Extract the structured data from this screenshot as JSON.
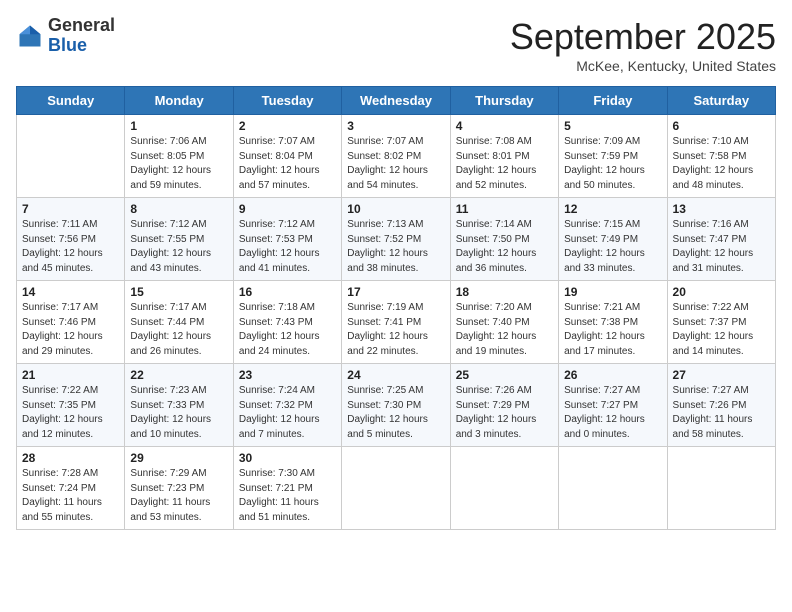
{
  "logo": {
    "general": "General",
    "blue": "Blue"
  },
  "header": {
    "month": "September 2025",
    "location": "McKee, Kentucky, United States"
  },
  "weekdays": [
    "Sunday",
    "Monday",
    "Tuesday",
    "Wednesday",
    "Thursday",
    "Friday",
    "Saturday"
  ],
  "weeks": [
    [
      {
        "day": "",
        "sunrise": "",
        "sunset": "",
        "daylight": ""
      },
      {
        "day": "1",
        "sunrise": "Sunrise: 7:06 AM",
        "sunset": "Sunset: 8:05 PM",
        "daylight": "Daylight: 12 hours and 59 minutes."
      },
      {
        "day": "2",
        "sunrise": "Sunrise: 7:07 AM",
        "sunset": "Sunset: 8:04 PM",
        "daylight": "Daylight: 12 hours and 57 minutes."
      },
      {
        "day": "3",
        "sunrise": "Sunrise: 7:07 AM",
        "sunset": "Sunset: 8:02 PM",
        "daylight": "Daylight: 12 hours and 54 minutes."
      },
      {
        "day": "4",
        "sunrise": "Sunrise: 7:08 AM",
        "sunset": "Sunset: 8:01 PM",
        "daylight": "Daylight: 12 hours and 52 minutes."
      },
      {
        "day": "5",
        "sunrise": "Sunrise: 7:09 AM",
        "sunset": "Sunset: 7:59 PM",
        "daylight": "Daylight: 12 hours and 50 minutes."
      },
      {
        "day": "6",
        "sunrise": "Sunrise: 7:10 AM",
        "sunset": "Sunset: 7:58 PM",
        "daylight": "Daylight: 12 hours and 48 minutes."
      }
    ],
    [
      {
        "day": "7",
        "sunrise": "Sunrise: 7:11 AM",
        "sunset": "Sunset: 7:56 PM",
        "daylight": "Daylight: 12 hours and 45 minutes."
      },
      {
        "day": "8",
        "sunrise": "Sunrise: 7:12 AM",
        "sunset": "Sunset: 7:55 PM",
        "daylight": "Daylight: 12 hours and 43 minutes."
      },
      {
        "day": "9",
        "sunrise": "Sunrise: 7:12 AM",
        "sunset": "Sunset: 7:53 PM",
        "daylight": "Daylight: 12 hours and 41 minutes."
      },
      {
        "day": "10",
        "sunrise": "Sunrise: 7:13 AM",
        "sunset": "Sunset: 7:52 PM",
        "daylight": "Daylight: 12 hours and 38 minutes."
      },
      {
        "day": "11",
        "sunrise": "Sunrise: 7:14 AM",
        "sunset": "Sunset: 7:50 PM",
        "daylight": "Daylight: 12 hours and 36 minutes."
      },
      {
        "day": "12",
        "sunrise": "Sunrise: 7:15 AM",
        "sunset": "Sunset: 7:49 PM",
        "daylight": "Daylight: 12 hours and 33 minutes."
      },
      {
        "day": "13",
        "sunrise": "Sunrise: 7:16 AM",
        "sunset": "Sunset: 7:47 PM",
        "daylight": "Daylight: 12 hours and 31 minutes."
      }
    ],
    [
      {
        "day": "14",
        "sunrise": "Sunrise: 7:17 AM",
        "sunset": "Sunset: 7:46 PM",
        "daylight": "Daylight: 12 hours and 29 minutes."
      },
      {
        "day": "15",
        "sunrise": "Sunrise: 7:17 AM",
        "sunset": "Sunset: 7:44 PM",
        "daylight": "Daylight: 12 hours and 26 minutes."
      },
      {
        "day": "16",
        "sunrise": "Sunrise: 7:18 AM",
        "sunset": "Sunset: 7:43 PM",
        "daylight": "Daylight: 12 hours and 24 minutes."
      },
      {
        "day": "17",
        "sunrise": "Sunrise: 7:19 AM",
        "sunset": "Sunset: 7:41 PM",
        "daylight": "Daylight: 12 hours and 22 minutes."
      },
      {
        "day": "18",
        "sunrise": "Sunrise: 7:20 AM",
        "sunset": "Sunset: 7:40 PM",
        "daylight": "Daylight: 12 hours and 19 minutes."
      },
      {
        "day": "19",
        "sunrise": "Sunrise: 7:21 AM",
        "sunset": "Sunset: 7:38 PM",
        "daylight": "Daylight: 12 hours and 17 minutes."
      },
      {
        "day": "20",
        "sunrise": "Sunrise: 7:22 AM",
        "sunset": "Sunset: 7:37 PM",
        "daylight": "Daylight: 12 hours and 14 minutes."
      }
    ],
    [
      {
        "day": "21",
        "sunrise": "Sunrise: 7:22 AM",
        "sunset": "Sunset: 7:35 PM",
        "daylight": "Daylight: 12 hours and 12 minutes."
      },
      {
        "day": "22",
        "sunrise": "Sunrise: 7:23 AM",
        "sunset": "Sunset: 7:33 PM",
        "daylight": "Daylight: 12 hours and 10 minutes."
      },
      {
        "day": "23",
        "sunrise": "Sunrise: 7:24 AM",
        "sunset": "Sunset: 7:32 PM",
        "daylight": "Daylight: 12 hours and 7 minutes."
      },
      {
        "day": "24",
        "sunrise": "Sunrise: 7:25 AM",
        "sunset": "Sunset: 7:30 PM",
        "daylight": "Daylight: 12 hours and 5 minutes."
      },
      {
        "day": "25",
        "sunrise": "Sunrise: 7:26 AM",
        "sunset": "Sunset: 7:29 PM",
        "daylight": "Daylight: 12 hours and 3 minutes."
      },
      {
        "day": "26",
        "sunrise": "Sunrise: 7:27 AM",
        "sunset": "Sunset: 7:27 PM",
        "daylight": "Daylight: 12 hours and 0 minutes."
      },
      {
        "day": "27",
        "sunrise": "Sunrise: 7:27 AM",
        "sunset": "Sunset: 7:26 PM",
        "daylight": "Daylight: 11 hours and 58 minutes."
      }
    ],
    [
      {
        "day": "28",
        "sunrise": "Sunrise: 7:28 AM",
        "sunset": "Sunset: 7:24 PM",
        "daylight": "Daylight: 11 hours and 55 minutes."
      },
      {
        "day": "29",
        "sunrise": "Sunrise: 7:29 AM",
        "sunset": "Sunset: 7:23 PM",
        "daylight": "Daylight: 11 hours and 53 minutes."
      },
      {
        "day": "30",
        "sunrise": "Sunrise: 7:30 AM",
        "sunset": "Sunset: 7:21 PM",
        "daylight": "Daylight: 11 hours and 51 minutes."
      },
      {
        "day": "",
        "sunrise": "",
        "sunset": "",
        "daylight": ""
      },
      {
        "day": "",
        "sunrise": "",
        "sunset": "",
        "daylight": ""
      },
      {
        "day": "",
        "sunrise": "",
        "sunset": "",
        "daylight": ""
      },
      {
        "day": "",
        "sunrise": "",
        "sunset": "",
        "daylight": ""
      }
    ]
  ]
}
